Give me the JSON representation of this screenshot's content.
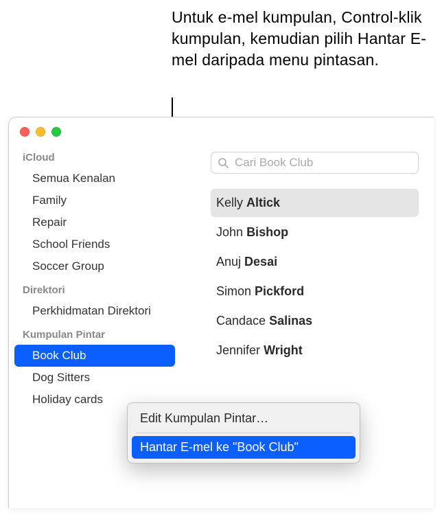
{
  "callout": "Untuk e-mel kumpulan, Control-klik kumpulan, kemudian pilih Hantar E-mel daripada menu pintasan.",
  "sidebar": {
    "sections": [
      {
        "header": "iCloud",
        "items": [
          {
            "label": "Semua Kenalan",
            "selected": false
          },
          {
            "label": "Family",
            "selected": false
          },
          {
            "label": "Repair",
            "selected": false
          },
          {
            "label": "School Friends",
            "selected": false
          },
          {
            "label": "Soccer Group",
            "selected": false
          }
        ]
      },
      {
        "header": "Direktori",
        "items": [
          {
            "label": "Perkhidmatan Direktori",
            "selected": false
          }
        ]
      },
      {
        "header": "Kumpulan Pintar",
        "items": [
          {
            "label": "Book Club",
            "selected": true
          },
          {
            "label": "Dog Sitters",
            "selected": false
          },
          {
            "label": "Holiday cards",
            "selected": false
          }
        ]
      }
    ]
  },
  "search": {
    "placeholder": "Cari Book Club",
    "value": ""
  },
  "contacts": [
    {
      "first": "Kelly",
      "last": "Altick",
      "selected": true
    },
    {
      "first": "John",
      "last": "Bishop",
      "selected": false
    },
    {
      "first": "Anuj",
      "last": "Desai",
      "selected": false
    },
    {
      "first": "Simon",
      "last": "Pickford",
      "selected": false
    },
    {
      "first": "Candace",
      "last": "Salinas",
      "selected": false
    },
    {
      "first": "Jennifer",
      "last": "Wright",
      "selected": false
    }
  ],
  "context_menu": {
    "items": [
      {
        "label": "Edit Kumpulan Pintar…",
        "highlighted": false
      },
      {
        "label": "Hantar E-mel ke \"Book Club\"",
        "highlighted": true
      }
    ]
  }
}
